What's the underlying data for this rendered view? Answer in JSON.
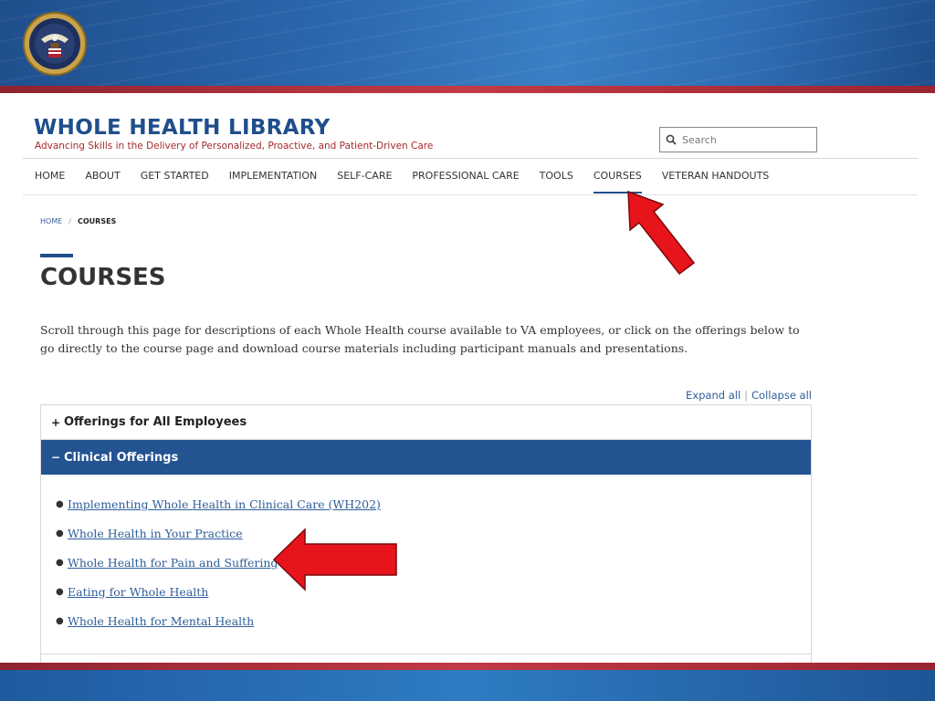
{
  "header": {
    "site_title": "WHOLE HEALTH LIBRARY",
    "tagline": "Advancing Skills in the Delivery of Personalized, Proactive, and Patient-Driven Care",
    "search_placeholder": "Search"
  },
  "nav": {
    "items": [
      {
        "label": "HOME"
      },
      {
        "label": "ABOUT"
      },
      {
        "label": "GET STARTED"
      },
      {
        "label": "IMPLEMENTATION"
      },
      {
        "label": "SELF-CARE"
      },
      {
        "label": "PROFESSIONAL CARE"
      },
      {
        "label": "TOOLS"
      },
      {
        "label": "COURSES"
      },
      {
        "label": "VETERAN HANDOUTS"
      }
    ],
    "active": "COURSES"
  },
  "breadcrumb": {
    "home": "HOME",
    "separator": "/",
    "current": "COURSES"
  },
  "page": {
    "title": "COURSES",
    "intro": "Scroll through this page for descriptions of each Whole Health course available to VA employees, or click on the offerings below to go directly to the course page and download course materials including participant manuals and presentations."
  },
  "accordion_controls": {
    "expand_all": "Expand all",
    "separator": "|",
    "collapse_all": "Collapse all"
  },
  "accordion": {
    "sections": [
      {
        "sign": "+",
        "title": "Offerings for All Employees",
        "state": "collapsed"
      },
      {
        "sign": "−",
        "title": "Clinical Offerings",
        "state": "expanded"
      }
    ],
    "clinical_items": [
      "Implementing Whole Health in Clinical Care (WH202)",
      "Whole Health in Your Practice",
      "Whole Health for Pain and Suffering",
      "Eating for Whole Health",
      "Whole Health for Mental Health"
    ]
  },
  "colors": {
    "brand_blue": "#1f4e8c",
    "accordion_open": "#245392",
    "link": "#2e5e99",
    "tagline_red": "#a52a2a",
    "arrow_red": "#e8141b"
  },
  "icons": {
    "seal": "va-seal-icon",
    "search": "search-icon",
    "arrow_courses": "red-arrow-up-icon",
    "arrow_pain": "red-arrow-left-icon"
  }
}
